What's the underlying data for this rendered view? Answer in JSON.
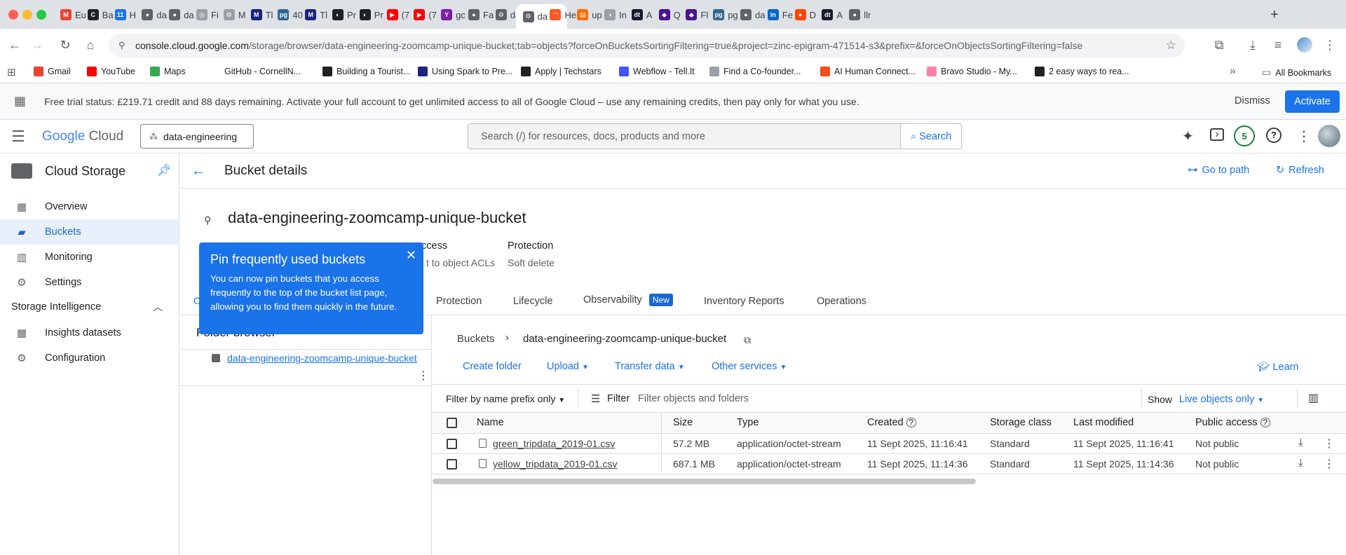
{
  "browser": {
    "tabs": [
      {
        "label": "Eu",
        "color": "#ea4335",
        "glyph": "M"
      },
      {
        "label": "Ba",
        "color": "#202124",
        "glyph": "C"
      },
      {
        "label": "H",
        "color": "#1a73e8",
        "glyph": "11"
      },
      {
        "label": "da",
        "color": "#5f6368",
        "glyph": "●"
      },
      {
        "label": "da",
        "color": "#5f6368",
        "glyph": "●"
      },
      {
        "label": "Fi",
        "color": "#9aa0a6",
        "glyph": "◎"
      },
      {
        "label": "M",
        "color": "#9aa0a6",
        "glyph": "⚙"
      },
      {
        "label": "Tl",
        "color": "#1a237e",
        "glyph": "M"
      },
      {
        "label": "40",
        "color": "#336791",
        "glyph": "pg"
      },
      {
        "label": "Tl",
        "color": "#1a237e",
        "glyph": "M"
      },
      {
        "label": "Pr",
        "color": "#202124",
        "glyph": "◐"
      },
      {
        "label": "Pr",
        "color": "#202124",
        "glyph": "◐"
      },
      {
        "label": "(7",
        "color": "#ff0000",
        "glyph": "▶"
      },
      {
        "label": "(7",
        "color": "#ff0000",
        "glyph": "▶"
      },
      {
        "label": "gc",
        "color": "#7b1fa2",
        "glyph": "Y"
      },
      {
        "label": "Fa",
        "color": "#5f6368",
        "glyph": "●"
      },
      {
        "label": "da",
        "color": "#5f6368",
        "glyph": "⚙"
      },
      {
        "label": "da",
        "color": "#5f6368",
        "glyph": "⚙",
        "active": true
      },
      {
        "label": "He",
        "color": "#ff5722",
        "glyph": "◠"
      },
      {
        "label": "up",
        "color": "#ff6d00",
        "glyph": "▤"
      },
      {
        "label": "In",
        "color": "#9aa0a6",
        "glyph": "◑"
      },
      {
        "label": "A",
        "color": "#1a1a2e",
        "glyph": "dt"
      },
      {
        "label": "Q",
        "color": "#4a148c",
        "glyph": "◆"
      },
      {
        "label": "Fl",
        "color": "#4a148c",
        "glyph": "◆"
      },
      {
        "label": "pg",
        "color": "#336791",
        "glyph": "pg"
      },
      {
        "label": "da",
        "color": "#5f6368",
        "glyph": "●"
      },
      {
        "label": "Fe",
        "color": "#0a66c2",
        "glyph": "in"
      },
      {
        "label": "D",
        "color": "#ff4500",
        "glyph": "●"
      },
      {
        "label": "A",
        "color": "#1a1a2e",
        "glyph": "dt"
      },
      {
        "label": "llr",
        "color": "#5f6368",
        "glyph": "●"
      }
    ],
    "new_tab": "+",
    "url_host": "console.cloud.google.com",
    "url_path": "/storage/browser/data-engineering-zoomcamp-unique-bucket;tab=objects?forceOnBucketsSortingFiltering=true&project=zinc-epigram-471514-s3&prefix=&forceOnObjectsSortingFiltering=false",
    "bookmarks": [
      {
        "label": "Gmail",
        "color": "#ea4335"
      },
      {
        "label": "YouTube",
        "color": "#ff0000"
      },
      {
        "label": "Maps",
        "color": "#34a853"
      },
      {
        "label": "GitHub - CornellN...",
        "color": "#ffffff"
      },
      {
        "label": "Building a Tourist...",
        "color": "#202124"
      },
      {
        "label": "Using Spark to Pre...",
        "color": "#1a237e"
      },
      {
        "label": "Apply | Techstars",
        "color": "#202124"
      },
      {
        "label": "Webflow - Tell.It",
        "color": "#4353ff"
      },
      {
        "label": "Find a Co-founder...",
        "color": "#9aa0a6"
      },
      {
        "label": "AI Human Connect...",
        "color": "#f24e1e"
      },
      {
        "label": "Bravo Studio - My...",
        "color": "#ff80ab"
      },
      {
        "label": "2 easy ways to rea...",
        "color": "#202124"
      }
    ],
    "more_bookmarks": "»",
    "all_bookmarks": "All Bookmarks"
  },
  "banner": {
    "message": "Free trial status: £219.71 credit and 88 days remaining. Activate your full account to get unlimited access to all of Google Cloud – use any remaining credits, then pay only for what you use.",
    "dismiss": "Dismiss",
    "activate": "Activate"
  },
  "header": {
    "logo_google": "Google",
    "logo_cloud": "Cloud",
    "project": "data-engineering",
    "search_placeholder": "Search (/) for resources, docs, products and more",
    "search_button": "Search",
    "notification_count": "5"
  },
  "sidebar": {
    "product": "Cloud Storage",
    "items": [
      {
        "label": "Overview",
        "icon": "dashboard-icon"
      },
      {
        "label": "Buckets",
        "icon": "bucket-icon",
        "selected": true
      },
      {
        "label": "Monitoring",
        "icon": "monitoring-icon"
      },
      {
        "label": "Settings",
        "icon": "gear-icon"
      }
    ],
    "section": "Storage Intelligence",
    "section_items": [
      {
        "label": "Insights datasets",
        "icon": "dataset-icon"
      },
      {
        "label": "Configuration",
        "icon": "config-icon"
      }
    ]
  },
  "page": {
    "title": "Bucket details",
    "go_to_path": "Go to path",
    "refresh": "Refresh",
    "bucket_name": "data-engineering-zoomcamp-unique-bucket",
    "props": {
      "access_label": "ccess",
      "access_value": "t to object ACLs",
      "protection_label": "Protection",
      "protection_value": "Soft delete"
    },
    "tabs": [
      "Protection",
      "Lifecycle",
      "Observability",
      "Inventory Reports",
      "Operations"
    ],
    "new_badge": "New",
    "folder_browser": "Folder browser",
    "folder_item": "data-engineering-zoomcamp-unique-bucket",
    "breadcrumb_root": "Buckets",
    "breadcrumb_current": "data-engineering-zoomcamp-unique-bucket",
    "actions": {
      "create_folder": "Create folder",
      "upload": "Upload",
      "transfer": "Transfer data",
      "other": "Other services",
      "learn": "Learn"
    },
    "filter": {
      "mode": "Filter by name prefix only",
      "label": "Filter",
      "placeholder": "Filter objects and folders",
      "show_label": "Show",
      "show_value": "Live objects only"
    },
    "columns": [
      "Name",
      "Size",
      "Type",
      "Created",
      "Storage class",
      "Last modified",
      "Public access"
    ],
    "rows": [
      {
        "name": "green_tripdata_2019-01.csv",
        "size": "57.2 MB",
        "type": "application/octet-stream",
        "created": "11 Sept 2025, 11:16:41",
        "class": "Standard",
        "modified": "11 Sept 2025, 11:16:41",
        "public": "Not public"
      },
      {
        "name": "yellow_tripdata_2019-01.csv",
        "size": "687.1 MB",
        "type": "application/octet-stream",
        "created": "11 Sept 2025, 11:14:36",
        "class": "Standard",
        "modified": "11 Sept 2025, 11:14:36",
        "public": "Not public"
      }
    ]
  },
  "popup": {
    "title": "Pin frequently used buckets",
    "body": "You can now pin buckets that you access frequently to the top of the bucket list page, allowing you to find them quickly in the future."
  }
}
